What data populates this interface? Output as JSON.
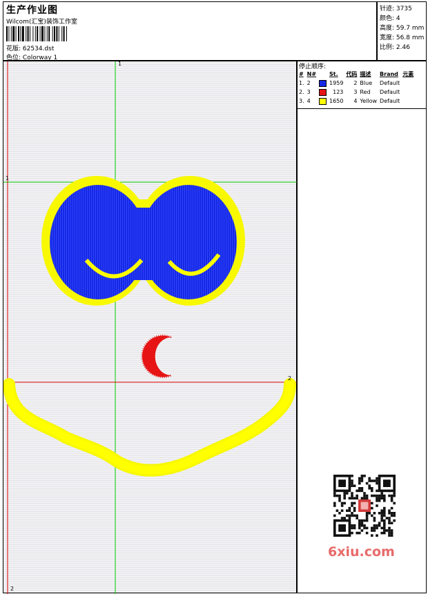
{
  "header": {
    "title": "生产作业图",
    "company": "Wilcom(汇宝)装饰工作室",
    "design_label": "花版:",
    "design_file": "62534.dst",
    "colorway_label": "色位:",
    "colorway": "Colorway 1"
  },
  "stats": [
    {
      "label": "针迹:",
      "value": "3735"
    },
    {
      "label": "颜色:",
      "value": "4"
    },
    {
      "label": "高度:",
      "value": "59.7 mm"
    },
    {
      "label": "宽度:",
      "value": "56.8 mm"
    },
    {
      "label": "比例:",
      "value": "2.46"
    }
  ],
  "legend": {
    "title": "停止顺序:",
    "columns": [
      "#",
      "N#",
      "St.",
      "代码",
      "描述",
      "Brand",
      "元素"
    ],
    "rows": [
      {
        "num": "1.",
        "n": "2",
        "color": "#1428e6",
        "st": "1959",
        "code": "2",
        "desc": "Blue",
        "brand": "Default"
      },
      {
        "num": "2.",
        "n": "3",
        "color": "#e61414",
        "st": "123",
        "code": "3",
        "desc": "Red",
        "brand": "Default"
      },
      {
        "num": "3.",
        "n": "4",
        "color": "#ffff00",
        "st": "1650",
        "code": "4",
        "desc": "Yellow",
        "brand": "Default"
      }
    ]
  },
  "markers": {
    "green_top": "1",
    "green_left": "1",
    "red_right": "2",
    "red_bottom": "2"
  },
  "watermark": "6xiu.com",
  "colors": {
    "blue": "#1428e6",
    "yellow": "#ffff00",
    "red": "#e61414",
    "guide_green": "#00cc00",
    "guide_red": "#e00000"
  }
}
